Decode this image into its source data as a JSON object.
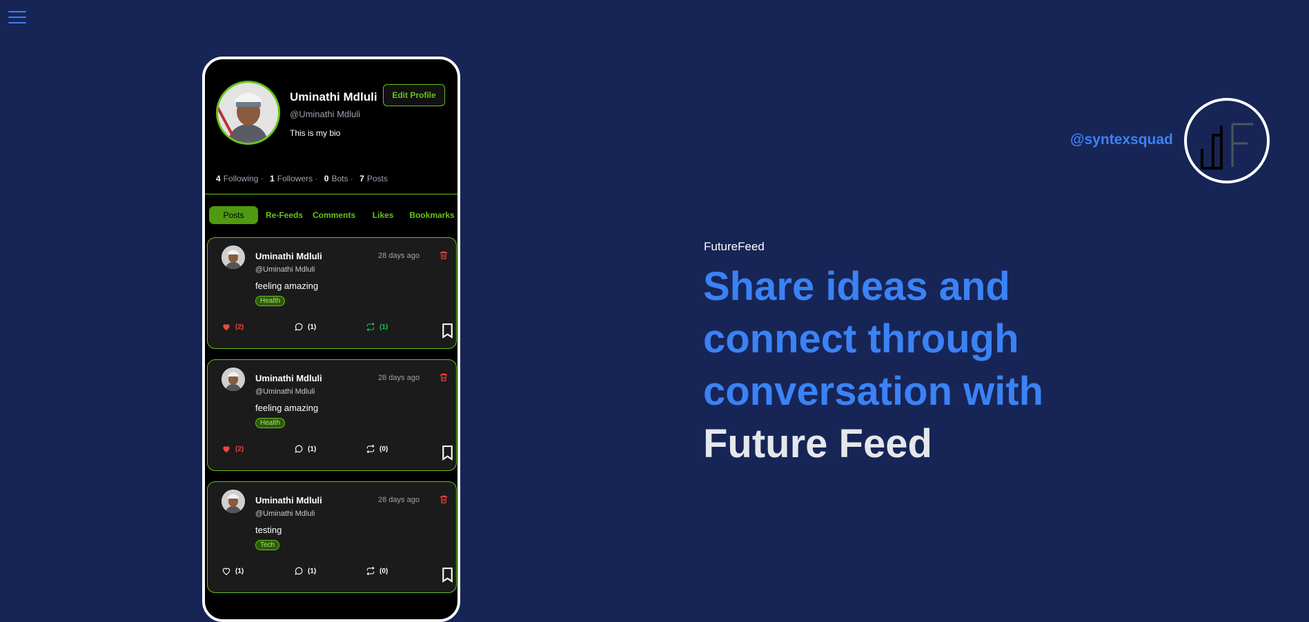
{
  "menu": {
    "icon": "hamburger-menu-icon"
  },
  "profile": {
    "name": "Uminathi Mdluli",
    "handle": "@Uminathi Mdluli",
    "bio": "This is my bio",
    "edit_label": "Edit Profile",
    "stats": {
      "following_count": "4",
      "following_label": "Following ·",
      "followers_count": "1",
      "followers_label": "Followers ·",
      "bots_count": "0",
      "bots_label": "Bots ·",
      "posts_count": "7",
      "posts_label": "Posts"
    }
  },
  "tabs": [
    {
      "label": "Posts",
      "active": true
    },
    {
      "label": "Re-Feeds"
    },
    {
      "label": "Comments"
    },
    {
      "label": "Likes"
    },
    {
      "label": "Bookmarks"
    }
  ],
  "posts": [
    {
      "author": "Uminathi Mdluli",
      "handle": "@Uminathi Mdluli",
      "time": "28 days ago",
      "text": "feeling amazing",
      "tag": "Health",
      "likes": "(2)",
      "liked": true,
      "comments": "(1)",
      "refeeds": "(1)",
      "refeeded": true
    },
    {
      "author": "Uminathi Mdluli",
      "handle": "@Uminathi Mdluli",
      "time": "28 days ago",
      "text": "feeling amazing",
      "tag": "Health",
      "likes": "(2)",
      "liked": true,
      "comments": "(1)",
      "refeeds": "(0)",
      "refeeded": false
    },
    {
      "author": "Uminathi Mdluli",
      "handle": "@Uminathi Mdluli",
      "time": "28 days ago",
      "text": "testing",
      "tag": "Tech",
      "likes": "(1)",
      "liked": false,
      "comments": "(1)",
      "refeeds": "(0)",
      "refeeded": false
    }
  ],
  "hero": {
    "brand": "FutureFeed",
    "line1": "Share ideas and",
    "line2": "connect through",
    "line3": "conversation with",
    "line4": "Future Feed"
  },
  "social": {
    "handle": "@syntexsquad",
    "logo_icon": "syntex-logo-icon"
  },
  "colors": {
    "background": "#172556",
    "accent_green": "#65c31a",
    "accent_blue": "#3b82f6",
    "like_red": "#ef4444",
    "refeed_green": "#22c55e"
  }
}
